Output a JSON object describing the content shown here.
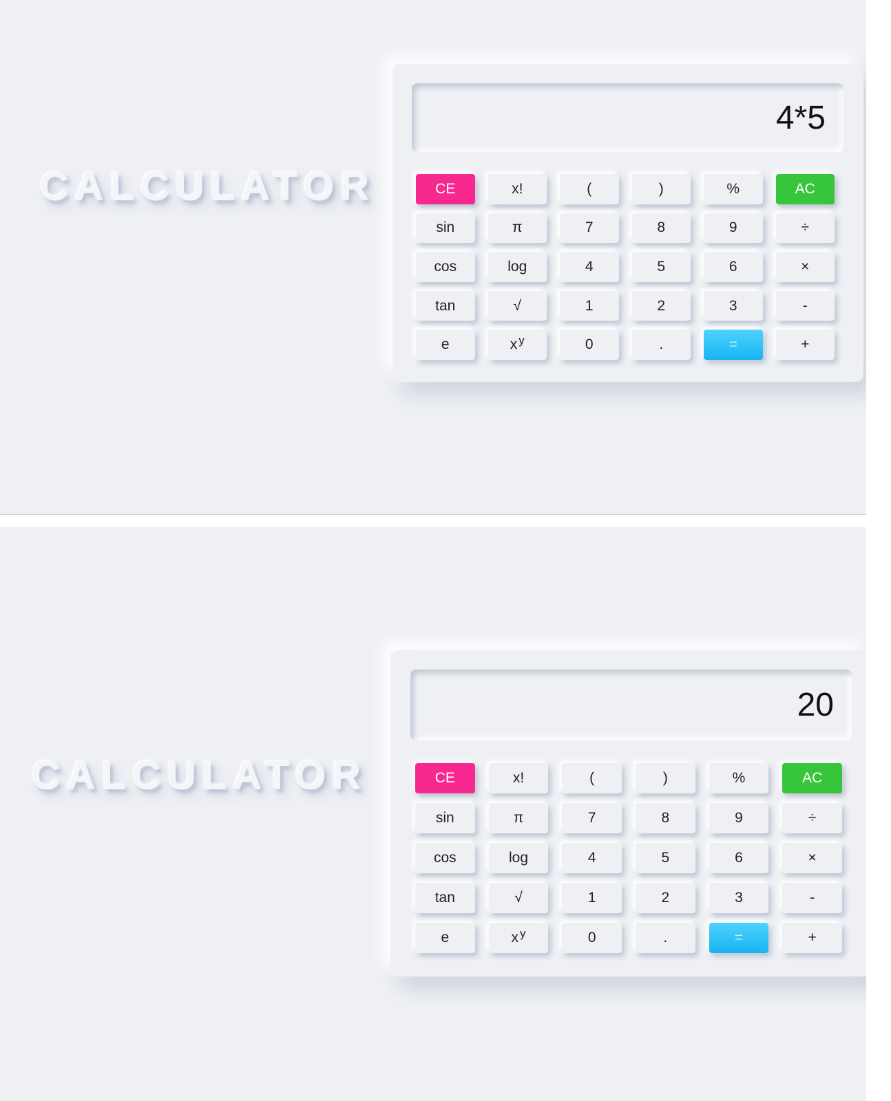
{
  "screens": [
    {
      "title": "CALCULATOR",
      "display": "4*5"
    },
    {
      "title": "CALCULATOR",
      "display": "20"
    }
  ],
  "keys": [
    [
      "CE",
      "x!",
      "(",
      ")",
      "%",
      "AC"
    ],
    [
      "sin",
      "π",
      "7",
      "8",
      "9",
      "÷"
    ],
    [
      "cos",
      "log",
      "4",
      "5",
      "6",
      "×"
    ],
    [
      "tan",
      "√",
      "1",
      "2",
      "3",
      "-"
    ],
    [
      "e",
      "x",
      "0",
      ".",
      "=",
      "+"
    ]
  ],
  "power_key_superscript": "y",
  "colors": {
    "background": "#eef0f4",
    "clear_entry_key": "#f7288e",
    "all_clear_key": "#37c53b",
    "equals_key": "#18b4f0"
  }
}
